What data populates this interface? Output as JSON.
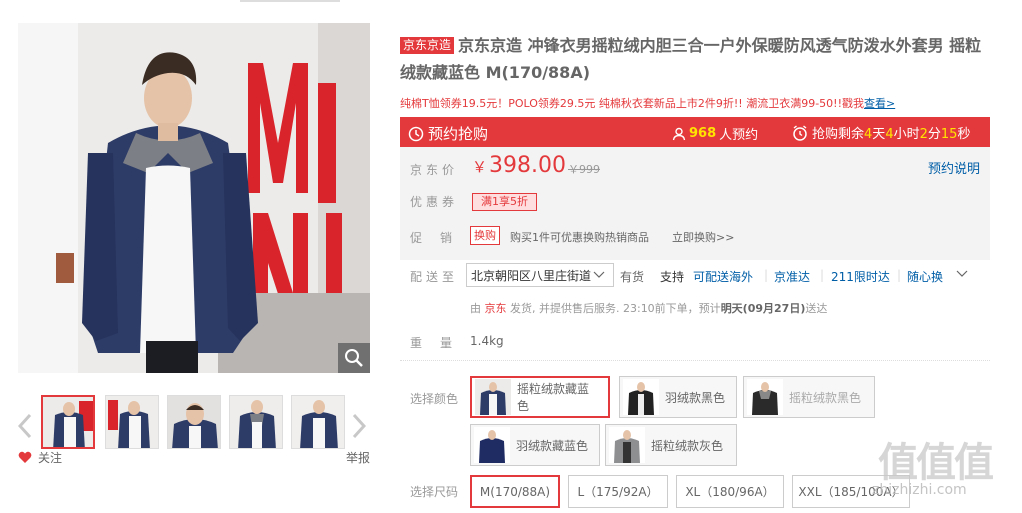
{
  "product": {
    "brand_tag": "京东京造",
    "title": "京东京造 冲锋衣男摇粒绒内胆三合一户外保暖防风透气防泼水外套男 摇粒绒款藏蓝色 M(170/88A)",
    "promo_text": "纯棉T恤领券19.5元！POLO领券29.5元 纯棉秋衣套新品上市2件9折!! 潮流卫衣满99-50!!戳我",
    "promo_link": "查看>"
  },
  "rush": {
    "title": "预约抢购",
    "count": "968",
    "count_suffix": "人预约",
    "timer_prefix": "抢购剩余",
    "days": "4",
    "days_unit": "天",
    "hours": "4",
    "hours_unit": "小时",
    "minutes": "2",
    "minutes_unit": "分",
    "seconds": "15",
    "seconds_unit": "秒",
    "color": "#e4393c"
  },
  "price": {
    "label": "京东价",
    "currency": "￥",
    "value": "398.00",
    "old_price": "￥999",
    "presale_link": "预约说明"
  },
  "coupon": {
    "label": "优惠券",
    "tag": "满1享5折"
  },
  "promotion": {
    "label": "促销",
    "tag": "换购",
    "desc": "购买1件可优惠换购热销商品",
    "link": "立即换购>>"
  },
  "delivery": {
    "label": "配送至",
    "address": "北京朝阳区八里庄街道",
    "stock": "有货",
    "support": "支持",
    "overseas": "可配送海外",
    "services": [
      "京准达",
      "211限时达",
      "随心换"
    ],
    "note_prefix": "由",
    "note_seller": "京东",
    "note_mid": "发货, 并提供售后服务. 23:10前下单，预计",
    "note_date": "明天(09月27日)",
    "note_suffix": "送达"
  },
  "weight": {
    "label": "重量",
    "value": "1.4kg"
  },
  "colors": {
    "label": "选择颜色",
    "options": [
      {
        "label": "摇粒绒款藏蓝色",
        "state": "selected"
      },
      {
        "label": "羽绒款黑色",
        "state": "normal"
      },
      {
        "label": "摇粒绒款黑色",
        "state": "disabled"
      },
      {
        "label": "羽绒款藏蓝色",
        "state": "normal"
      },
      {
        "label": "摇粒绒款灰色",
        "state": "normal"
      }
    ]
  },
  "sizes": {
    "label": "选择尺码",
    "options": [
      "M(170/88A)",
      "L（175/92A）",
      "XL（180/96A）",
      "XXL（185/100A）"
    ],
    "selected": "M(170/88A)"
  },
  "gallery": {
    "follow": "关注",
    "report": "举报"
  },
  "watermark": {
    "logo": "值值值",
    "site": "zhizhizhi.com"
  }
}
